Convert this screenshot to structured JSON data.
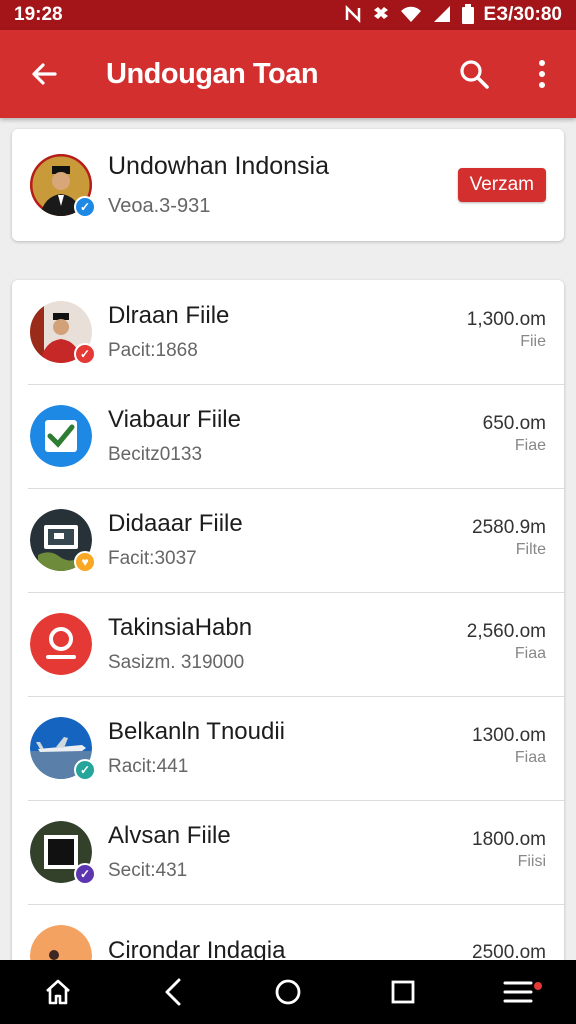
{
  "status_bar": {
    "time": "19:28",
    "right_text": "EЗ/30:80",
    "icons": [
      "nfc-icon",
      "dropbox-icon",
      "wifi-icon",
      "signal-icon",
      "battery-icon"
    ]
  },
  "app_bar": {
    "title": "Undougan Toan",
    "color": "#d32f2f",
    "icons": [
      "back-arrow-icon",
      "search-icon",
      "more-vert-icon"
    ]
  },
  "header_card": {
    "title": "Undowhan Indonsia",
    "subtitle": "Veoa.3-931",
    "button_label": "Verzam",
    "avatar_icon": "person-photo",
    "badge_icon": "check-icon"
  },
  "list": {
    "items": [
      {
        "title": "Dlraan Fiile",
        "subtitle": "Pacit:1868",
        "size": "1,300.om",
        "unit": "Fiie",
        "avatar": "person-photo",
        "badge_color": "#e53935"
      },
      {
        "title": "Viabaur Fiile",
        "subtitle": "Becitz0133",
        "size": "650.om",
        "unit": "Fiae",
        "avatar": "checkbox-icon",
        "badge_color": ""
      },
      {
        "title": "Didaaar Fiile",
        "subtitle": "Facit:3037",
        "size": "2580.9m",
        "unit": "Filte",
        "avatar": "monitor-photo",
        "badge_color": "#f9a825"
      },
      {
        "title": "TakinsiaHabn",
        "subtitle": "Sasizm. 319000",
        "size": "2,560.om",
        "unit": "Fiaa",
        "avatar": "location-icon",
        "badge_color": ""
      },
      {
        "title": "Belkanln Tnoudii",
        "subtitle": "Racit:441",
        "size": "1300.om",
        "unit": "Fiaa",
        "avatar": "airplane-photo",
        "badge_color": "#26a69a"
      },
      {
        "title": "Alvsan Fiile",
        "subtitle": "Secit:431",
        "size": "1800.om",
        "unit": "Fiisi",
        "avatar": "square-photo",
        "badge_color": "#5e35b1"
      },
      {
        "title": "Cirondar Indagia",
        "subtitle": "",
        "size": "2500.om",
        "unit": "",
        "avatar": "sunset-photo",
        "badge_color": ""
      }
    ]
  },
  "nav_bar": {
    "icons": [
      "home-icon",
      "back-icon",
      "home-circle-icon",
      "recents-icon",
      "menu-icon"
    ]
  }
}
